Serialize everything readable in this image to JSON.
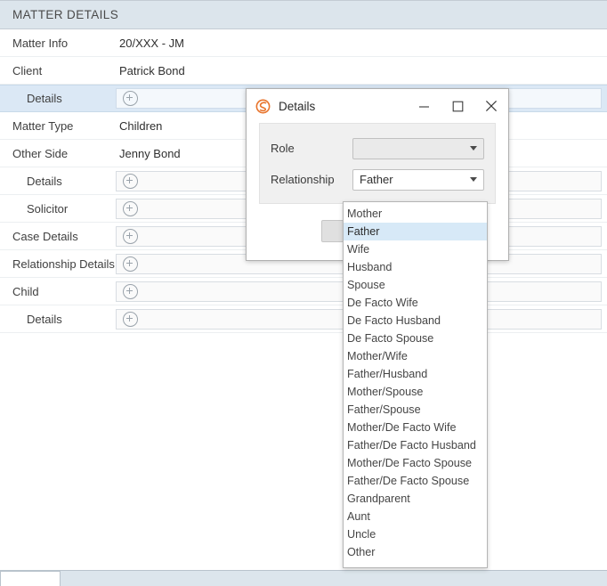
{
  "panel": {
    "header_title": "MATTER DETAILS",
    "rows": [
      {
        "label": "Matter Info",
        "type": "text",
        "value": "20/XXX - JM",
        "indent": 0,
        "selected": false
      },
      {
        "label": "Client",
        "type": "text",
        "value": "Patrick Bond",
        "indent": 0,
        "selected": false
      },
      {
        "label": "Details",
        "type": "plus",
        "value": "",
        "indent": 1,
        "selected": true,
        "icon": "plus-circle-icon"
      },
      {
        "label": "Matter Type",
        "type": "text",
        "value": "Children",
        "indent": 0,
        "selected": false
      },
      {
        "label": "Other Side",
        "type": "text",
        "value": "Jenny Bond",
        "indent": 0,
        "selected": false
      },
      {
        "label": "Details",
        "type": "plus",
        "value": "",
        "indent": 1,
        "selected": false,
        "icon": "plus-circle-icon"
      },
      {
        "label": "Solicitor",
        "type": "plus",
        "value": "",
        "indent": 1,
        "selected": false,
        "icon": "plus-circle-icon"
      },
      {
        "label": "Case Details",
        "type": "plus",
        "value": "",
        "indent": 0,
        "selected": false,
        "icon": "plus-circle-icon"
      },
      {
        "label": "Relationship Details",
        "type": "plus",
        "value": "",
        "indent": 0,
        "selected": false,
        "icon": "plus-circle-icon"
      },
      {
        "label": "Child",
        "type": "plus",
        "value": "",
        "indent": 0,
        "selected": false,
        "icon": "plus-circle-icon"
      },
      {
        "label": "Details",
        "type": "plus",
        "value": "",
        "indent": 1,
        "selected": false,
        "icon": "plus-circle-icon"
      }
    ]
  },
  "dialog": {
    "title": "Details",
    "logo_icon": "app-logo-s-icon",
    "logo_color": "#e8742c",
    "window_controls": {
      "minimize": "minimize-icon",
      "maximize": "maximize-icon",
      "close": "close-icon"
    },
    "form": {
      "role": {
        "label": "Role",
        "value": "",
        "disabled": true,
        "arrow_icon": "chevron-down-icon"
      },
      "relationship": {
        "label": "Relationship",
        "value": "Father",
        "disabled": false,
        "arrow_icon": "chevron-down-icon"
      }
    },
    "buttons": {
      "primary_label": "",
      "secondary_label": ""
    }
  },
  "dropdown": {
    "selected": "Father",
    "items": [
      "Mother",
      "Father",
      "Wife",
      "Husband",
      "Spouse",
      "De Facto Wife",
      "De Facto Husband",
      "De Facto Spouse",
      "Mother/Wife",
      "Father/Husband",
      "Mother/Spouse",
      "Father/Spouse",
      "Mother/De Facto Wife",
      "Father/De Facto Husband",
      "Mother/De Facto Spouse",
      "Father/De Facto Spouse",
      "Grandparent",
      "Aunt",
      "Uncle",
      "Other"
    ]
  },
  "colors": {
    "header_bg": "#dce5ec",
    "selected_row": "#dbe8f5",
    "dropdown_highlight": "#d7e9f7",
    "accent_orange": "#e8742c"
  }
}
